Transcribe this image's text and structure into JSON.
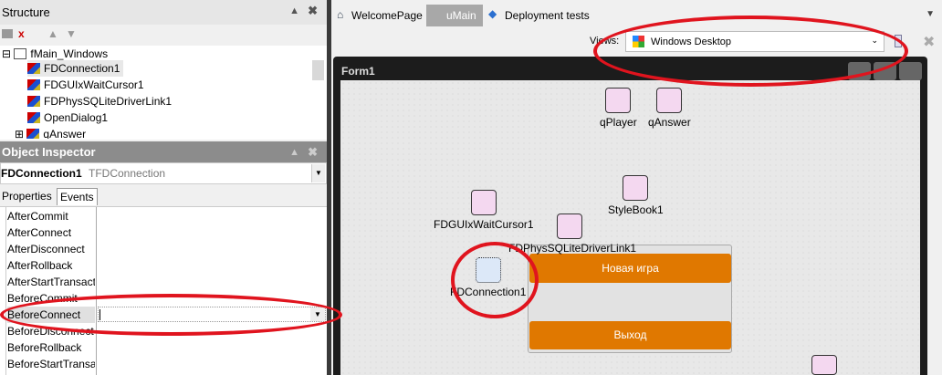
{
  "structure": {
    "title": "Structure",
    "tree": [
      {
        "label": "fMain_Windows",
        "level": 0
      },
      {
        "label": "FDConnection1",
        "level": 1,
        "selected": true
      },
      {
        "label": "FDGUIxWaitCursor1",
        "level": 1
      },
      {
        "label": "FDPhysSQLiteDriverLink1",
        "level": 1
      },
      {
        "label": "OpenDialog1",
        "level": 1
      },
      {
        "label": "qAnswer",
        "level": 1
      }
    ]
  },
  "inspector": {
    "title": "Object Inspector",
    "object_name": "FDConnection1",
    "object_type": "TFDConnection",
    "tabs": [
      "Properties",
      "Events"
    ],
    "active_tab": "Events",
    "events": [
      "AfterCommit",
      "AfterConnect",
      "AfterDisconnect",
      "AfterRollback",
      "AfterStartTransaction",
      "BeforeCommit",
      "BeforeConnect",
      "BeforeDisconnect",
      "BeforeRollback",
      "BeforeStartTransaction"
    ],
    "selected_event": "BeforeConnect",
    "selected_value": ""
  },
  "editor_tabs": [
    "WelcomePage",
    "uMain",
    "Deployment tests"
  ],
  "active_editor_tab": "uMain",
  "views": {
    "label": "Views:",
    "value": "Windows Desktop"
  },
  "form": {
    "title": "Form1",
    "components": [
      "qPlayer",
      "qAnswer",
      "StyleBook1",
      "FDGUIxWaitCursor1",
      "FDPhysSQLiteDriverLink1",
      "FDConnection1"
    ],
    "buttons": [
      "Новая игра",
      "Выход"
    ]
  },
  "colors": {
    "accent": "#e07800",
    "annotation": "#e0141e"
  }
}
